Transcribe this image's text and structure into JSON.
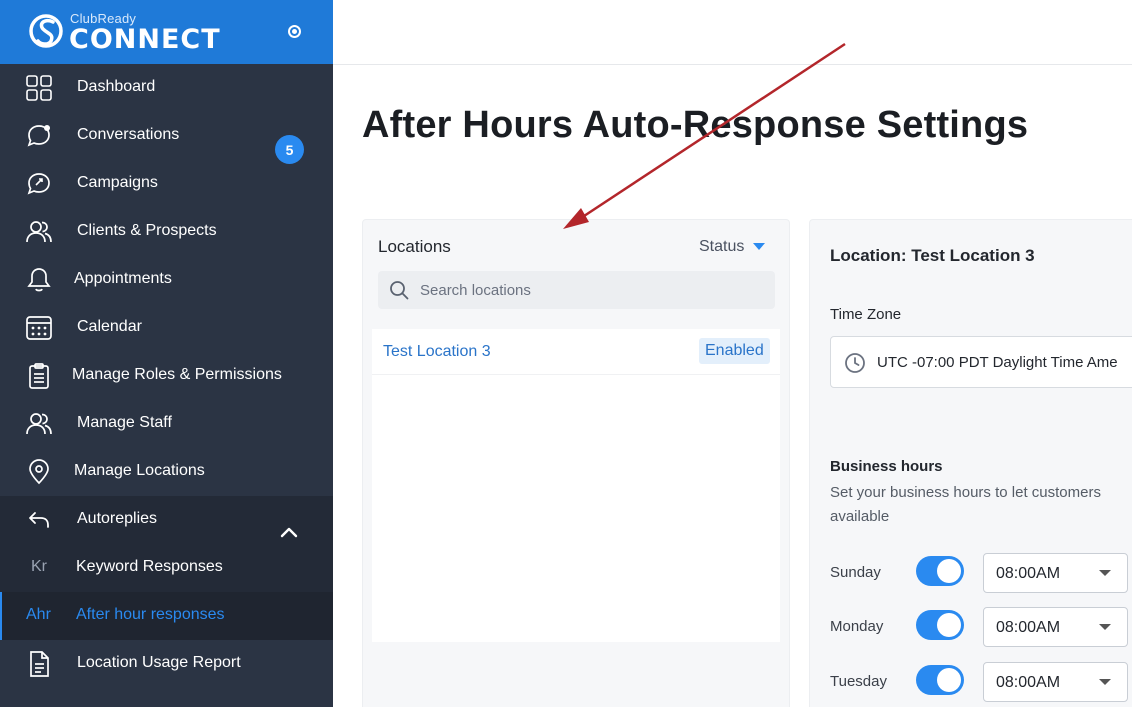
{
  "brand": {
    "small_text": "ClubReady",
    "big_text": "CONNECT"
  },
  "sidebar": {
    "items": [
      {
        "label": "Dashboard",
        "icon": "grid-icon"
      },
      {
        "label": "Conversations",
        "icon": "chat-bubble-icon",
        "badge": "5"
      },
      {
        "label": "Campaigns",
        "icon": "campaign-icon"
      },
      {
        "label": "Clients & Prospects",
        "icon": "users-icon"
      },
      {
        "label": "Appointments",
        "icon": "bell-icon"
      },
      {
        "label": "Calendar",
        "icon": "calendar-icon"
      },
      {
        "label": "Manage Roles & Permissions",
        "icon": "clipboard-icon"
      },
      {
        "label": "Manage Staff",
        "icon": "users-icon"
      },
      {
        "label": "Manage Locations",
        "icon": "map-pin-icon"
      },
      {
        "label": "Autoreplies",
        "icon": "reply-icon"
      },
      {
        "label": "Keyword Responses",
        "abbr": "Kr"
      },
      {
        "label": "After hour responses",
        "abbr": "Ahr"
      },
      {
        "label": "Location Usage Report",
        "icon": "document-icon"
      }
    ]
  },
  "page": {
    "title": "After Hours Auto-Response Settings"
  },
  "locations": {
    "title": "Locations",
    "status_filter": "Status",
    "search_placeholder": "Search locations",
    "rows": [
      {
        "name": "Test Location 3",
        "status": "Enabled"
      }
    ]
  },
  "detail": {
    "heading": "Location: Test Location 3",
    "time_zone_label": "Time Zone",
    "time_zone_value": "UTC -07:00 PDT Daylight Time Ame",
    "business_hours_title": "Business hours",
    "business_hours_desc": "Set your business hours to let customers available",
    "days": [
      {
        "name": "Sunday",
        "time": "08:00AM"
      },
      {
        "name": "Monday",
        "time": "08:00AM"
      },
      {
        "name": "Tuesday",
        "time": "08:00AM"
      }
    ]
  },
  "colors": {
    "accent": "#2a8af0",
    "sidebar": "#2b3444",
    "brand": "#1f7ad8",
    "annotation": "#b3262b"
  }
}
